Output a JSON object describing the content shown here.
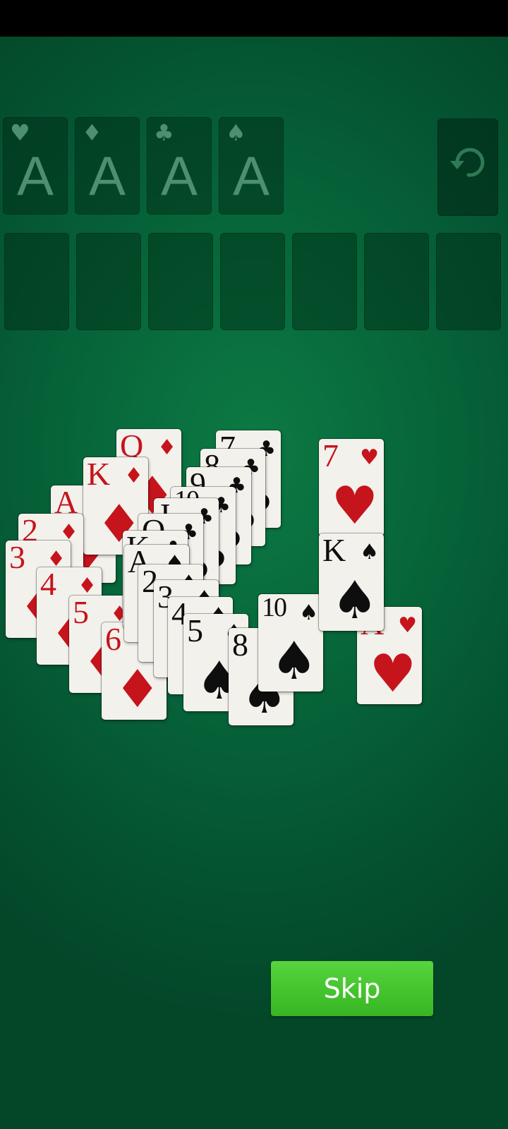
{
  "foundations": [
    {
      "suit": "hearts",
      "symbol": "♥",
      "label": "A"
    },
    {
      "suit": "diamonds",
      "symbol": "♦",
      "label": "A"
    },
    {
      "suit": "clubs",
      "symbol": "♣",
      "label": "A"
    },
    {
      "suit": "spades",
      "symbol": "♠",
      "label": "A"
    }
  ],
  "undo": {
    "icon": "undo-icon"
  },
  "tableau_slots": 7,
  "cards": [
    {
      "rank": "Q",
      "suit": "♦",
      "color": "red"
    },
    {
      "rank": "K",
      "suit": "♦",
      "color": "red"
    },
    {
      "rank": "A",
      "suit": "♦",
      "color": "red"
    },
    {
      "rank": "2",
      "suit": "♦",
      "color": "red"
    },
    {
      "rank": "3",
      "suit": "♦",
      "color": "red"
    },
    {
      "rank": "4",
      "suit": "♦",
      "color": "red"
    },
    {
      "rank": "5",
      "suit": "♦",
      "color": "red"
    },
    {
      "rank": "6",
      "suit": "♦",
      "color": "red"
    },
    {
      "rank": "7",
      "suit": "♥",
      "color": "red"
    },
    {
      "rank": "7",
      "suit": "♣",
      "color": "black"
    },
    {
      "rank": "8",
      "suit": "♣",
      "color": "black"
    },
    {
      "rank": "9",
      "suit": "♣",
      "color": "black"
    },
    {
      "rank": "10",
      "suit": "♣",
      "color": "black"
    },
    {
      "rank": "J",
      "suit": "♣",
      "color": "black"
    },
    {
      "rank": "Q",
      "suit": "♣",
      "color": "black"
    },
    {
      "rank": "K",
      "suit": "♣",
      "color": "black"
    },
    {
      "rank": "A",
      "suit": "♠",
      "color": "black"
    },
    {
      "rank": "2",
      "suit": "♠",
      "color": "black"
    },
    {
      "rank": "3",
      "suit": "♠",
      "color": "black"
    },
    {
      "rank": "4",
      "suit": "♠",
      "color": "black"
    },
    {
      "rank": "5",
      "suit": "♠",
      "color": "black"
    },
    {
      "rank": "8",
      "suit": "♠",
      "color": "black"
    },
    {
      "rank": "10",
      "suit": "♠",
      "color": "black"
    },
    {
      "rank": "K",
      "suit": "♠",
      "color": "black"
    },
    {
      "rank": "A",
      "suit": "♥",
      "color": "red"
    }
  ],
  "skip_button": {
    "label": "Skip"
  },
  "colors": {
    "felt": "#07663a",
    "red_suit": "#c6141c",
    "black_suit": "#0e0e0e",
    "button": "#46c52f"
  }
}
